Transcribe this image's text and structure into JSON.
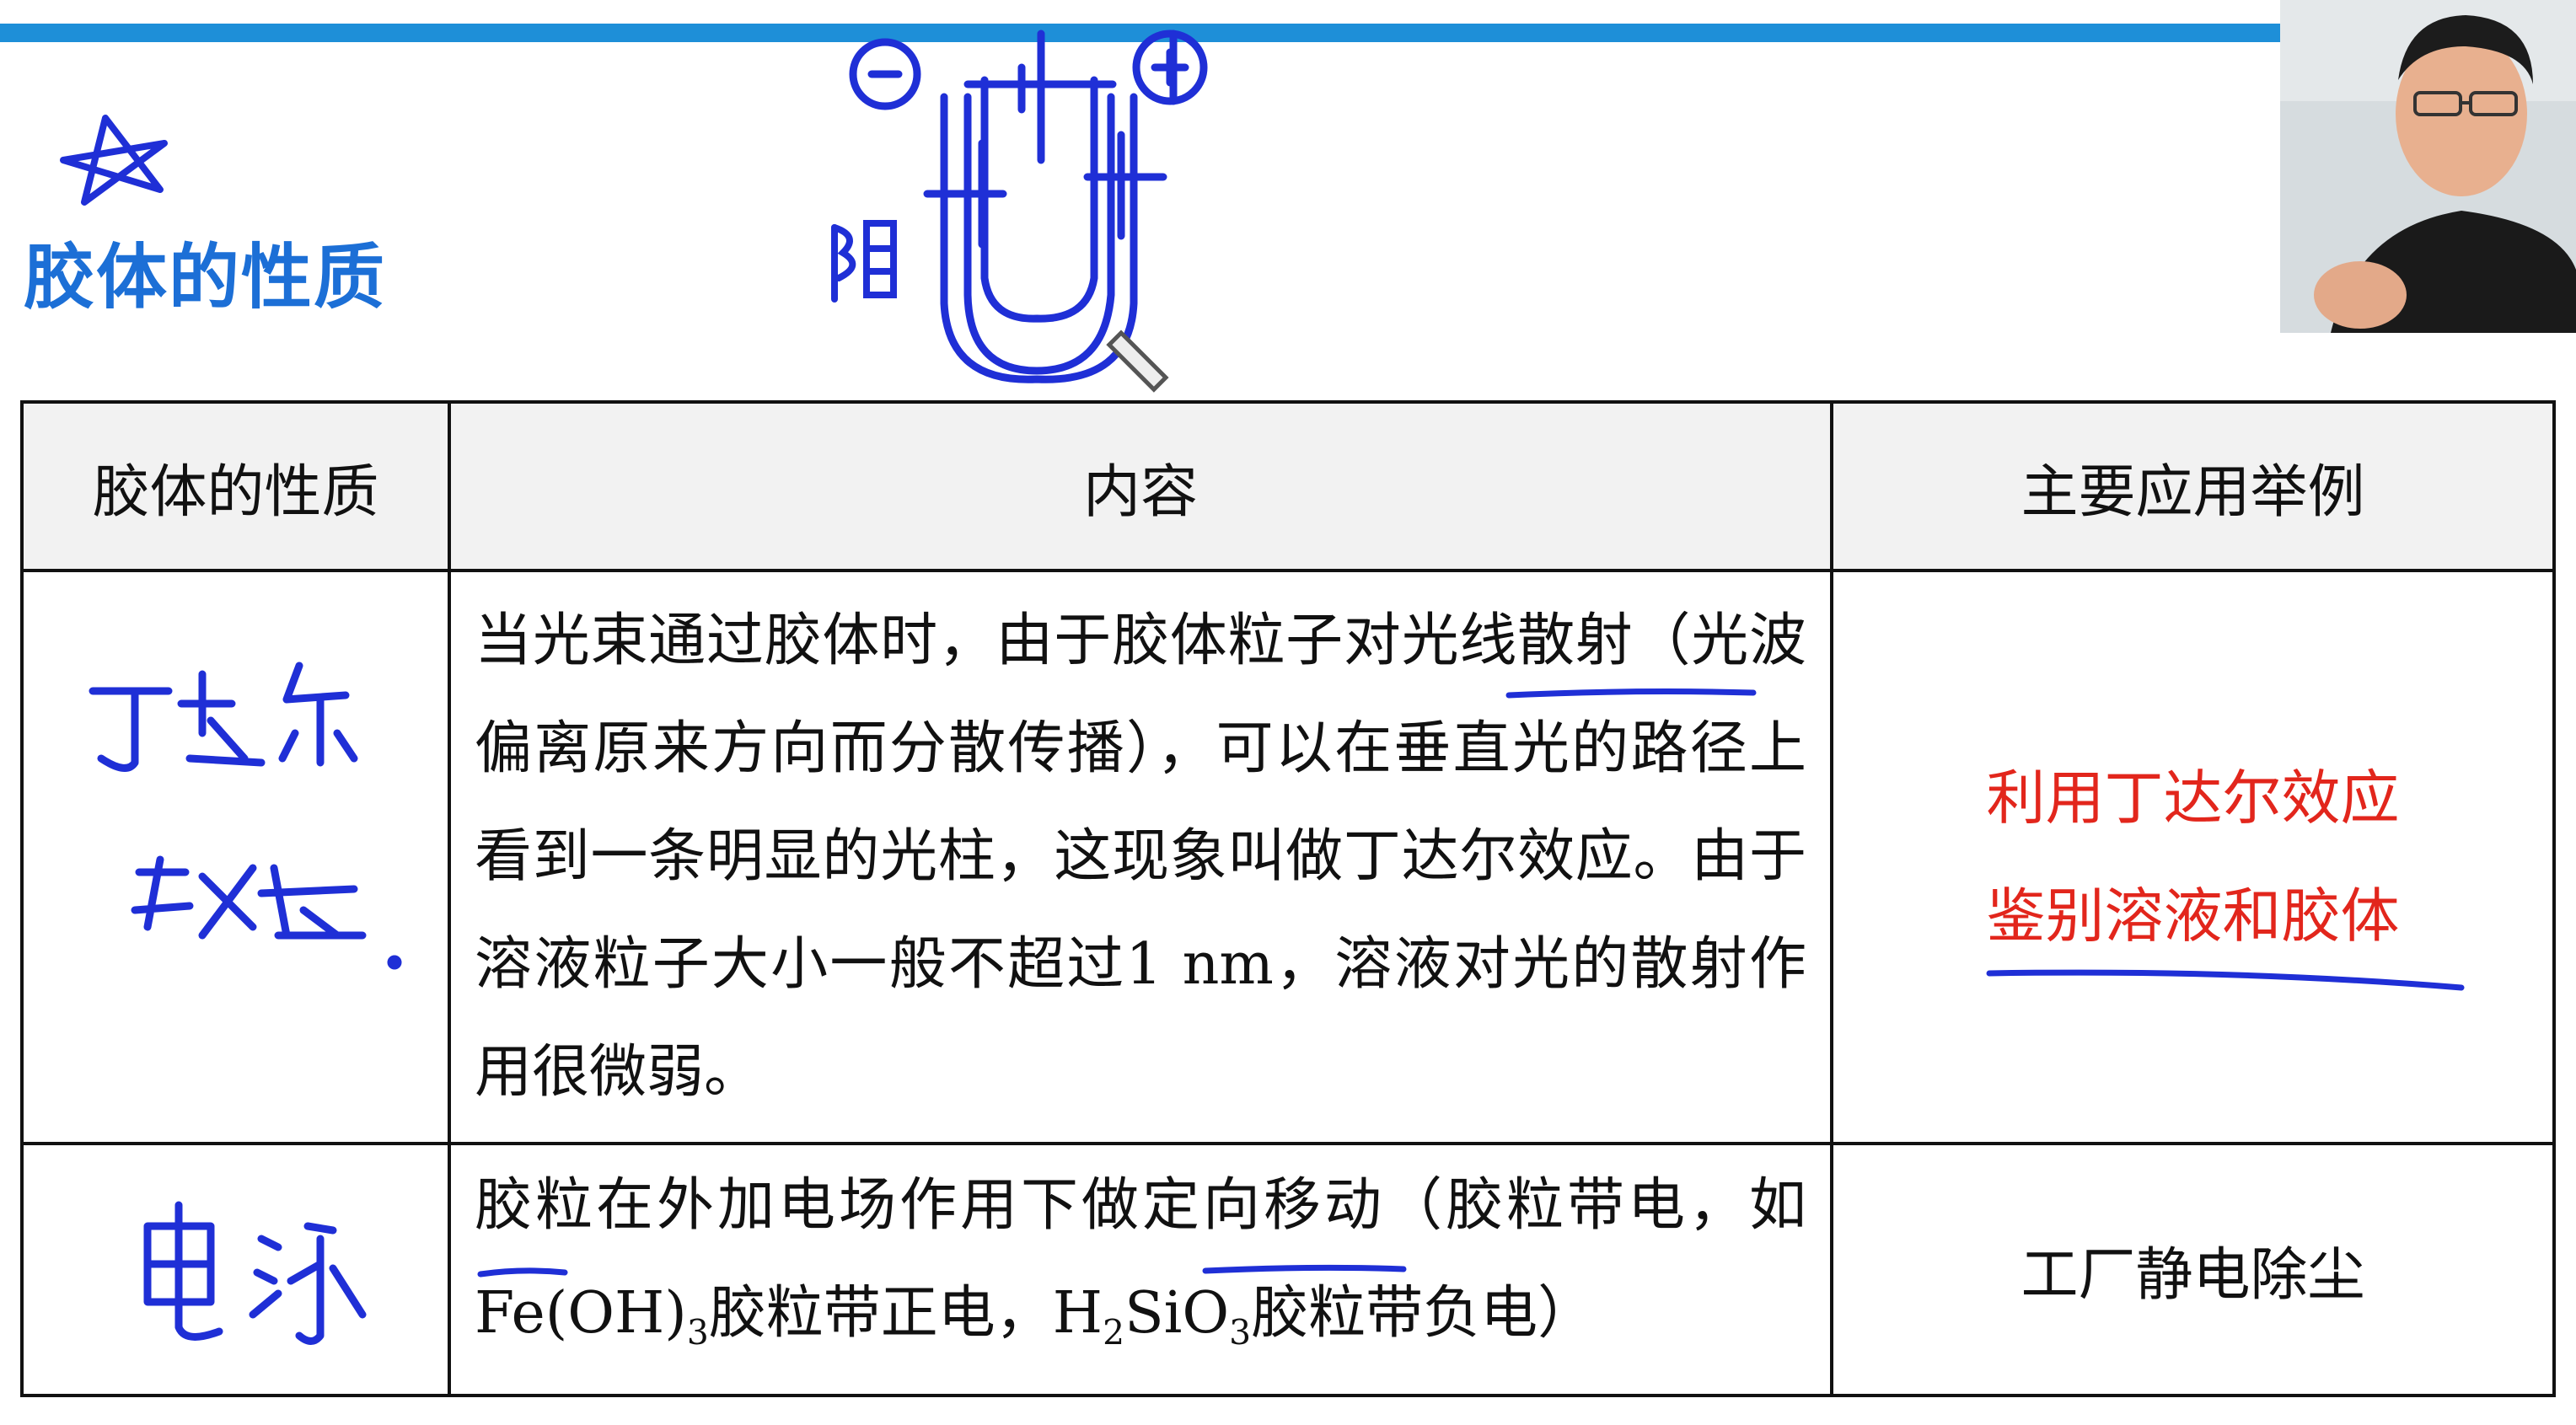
{
  "slide": {
    "title": "胶体的性质",
    "accent_color": "#1c6fd6",
    "topbar_color": "#1e8fd8"
  },
  "annotations": {
    "handwritten_color": "#1f2fd6",
    "star_icon": "star-icon",
    "anode_label": "阴",
    "minus_sign": "−",
    "plus_sign": "+",
    "row1_note": "丁达尔效应.",
    "row2_note": "电泳"
  },
  "table": {
    "headers": [
      "胶体的性质",
      "内容",
      "主要应用举例"
    ],
    "rows": [
      {
        "property": "",
        "content": "当光束通过胶体时，由于胶体粒子对光线散射（光波偏离原来方向而分散传播），可以在垂直光的路径上看到一条明显的光柱，这现象叫做丁达尔效应。由于溶液粒子大小一般不超过",
        "content_tail_num": "1 nm",
        "content_tail": "，溶液对光的散射作用很微弱。",
        "application_line1": "利用丁达尔效应",
        "application_line2": "鉴别溶液和胶体",
        "application_color": "#e2261c"
      },
      {
        "property": "",
        "content_a": "胶粒在外加电场作用下做定向移动（胶粒带电，如",
        "formula1": "Fe(OH)",
        "formula1_sub": "3",
        "content_b": "胶粒带正电，",
        "formula2_a": "H",
        "formula2_sub1": "2",
        "formula2_b": "SiO",
        "formula2_sub2": "3",
        "content_c": "胶粒带负电）",
        "application": "工厂静电除尘"
      }
    ]
  }
}
